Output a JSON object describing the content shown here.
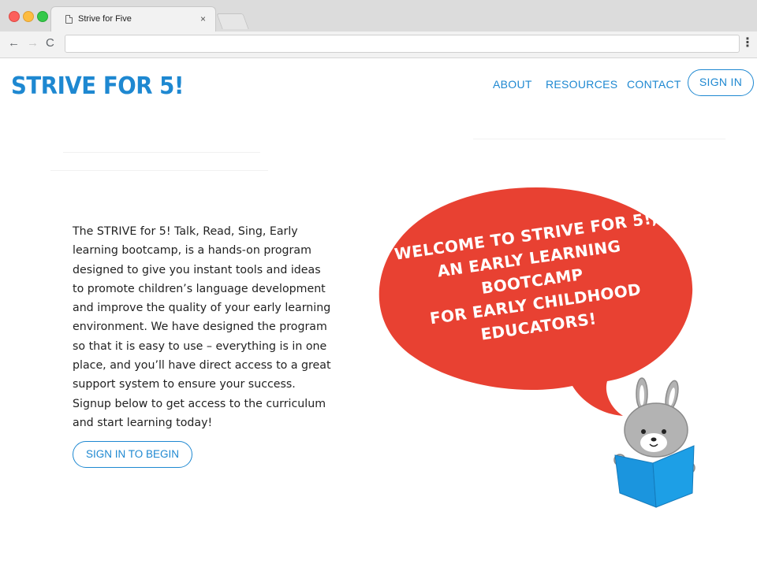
{
  "browser": {
    "tab_title": "Strive for Five",
    "tab_close": "×",
    "url": "",
    "menu_icon": "⋮"
  },
  "site": {
    "logo": "STRIVE FOR 5!",
    "nav": {
      "about": "ABOUT",
      "resources": "RESOURCES",
      "contact": "CONTACT",
      "sign_in": "SIGN IN"
    }
  },
  "main": {
    "intro": "The STRIVE for 5! Talk, Read, Sing, Early learning bootcamp, is a hands-on program designed to give you instant tools and ideas to promote children’s language development and improve the quality of your early learning environment. We have designed the program so that it is easy to use – everything is in one place, and you’ll have direct access to a great support system to ensure your success. Signup below to get access to the curriculum and start learning today!",
    "cta_label": "SIGN IN TO BEGIN"
  },
  "bubble": {
    "line1": "WELCOME TO STRIVE FOR 5!,",
    "line2": "AN EARLY LEARNING BOOTCAMP",
    "line3": "FOR EARLY CHILDHOOD",
    "line4": "EDUCATORS!"
  },
  "colors": {
    "accent": "#1e88d1",
    "bubble": "#e84132",
    "book": "#1b95de",
    "moon": "#f2c12e",
    "bunny": "#b3b3b3"
  },
  "icons": [
    "page-icon",
    "close-icon",
    "back-arrow-icon",
    "forward-arrow-icon",
    "reload-icon",
    "more-menu-icon"
  ]
}
